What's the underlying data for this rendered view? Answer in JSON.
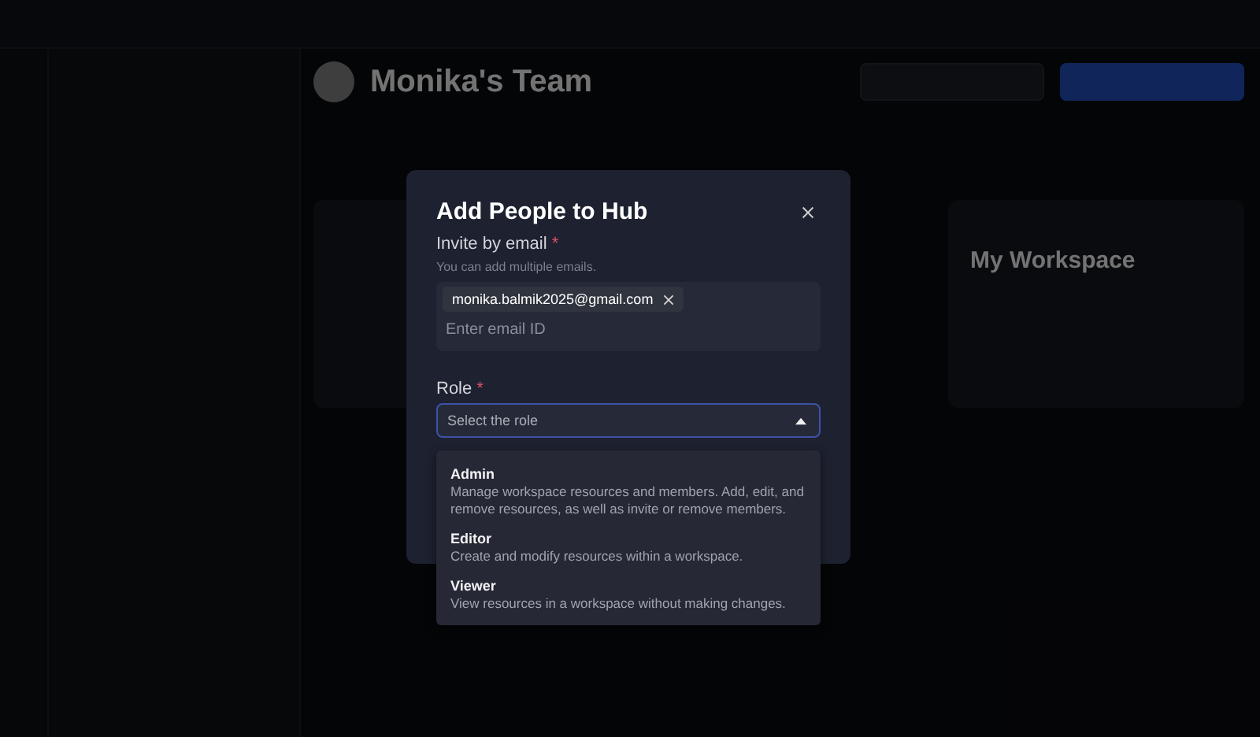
{
  "header": {
    "title": "Monika's Team"
  },
  "cards": [
    {
      "title": "My Workspace"
    }
  ],
  "dialog": {
    "title": "Add People to Hub",
    "email_label": "Invite by email",
    "email_required_mark": "*",
    "email_hint": "You can add multiple emails.",
    "chips": [
      {
        "label": "monika.balmik2025@gmail.com"
      }
    ],
    "email_placeholder": "Enter email ID",
    "role_label": "Role",
    "role_required_mark": "*",
    "role_placeholder": "Select the role",
    "role_menu": {
      "expanded": true,
      "options": [
        {
          "name": "Admin",
          "description": "Manage workspace resources and members. Add, edit, and remove resources, as well as invite or remove members."
        },
        {
          "name": "Editor",
          "description": "Create and modify resources within a workspace."
        },
        {
          "name": "Viewer",
          "description": "View resources in a workspace without making changes."
        }
      ]
    }
  }
}
